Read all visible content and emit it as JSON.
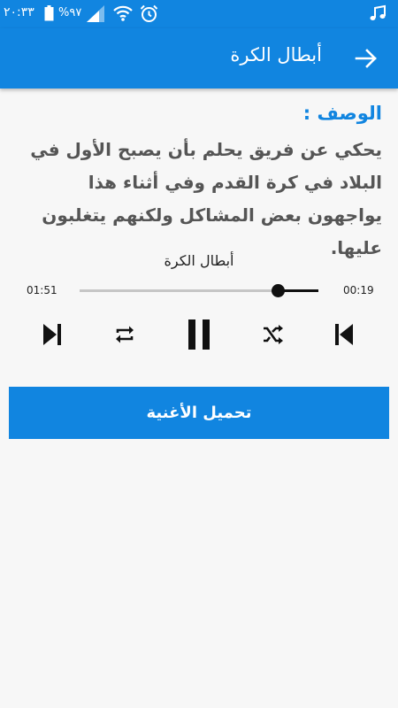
{
  "status_bar": {
    "time": "٢٠:٣٣",
    "battery": "%٩٧",
    "icons": [
      "music-icon",
      "alarm-icon",
      "wifi-icon",
      "signal-icon",
      "battery-icon"
    ]
  },
  "app_bar": {
    "title": "أبطال الكرة",
    "back_icon": "arrow-right-icon"
  },
  "description": {
    "heading": "الوصف :",
    "text": "يحكي عن فريق يحلم بأن يصبح الأول في البلاد في كرة القدم وفي أثناء هذا يواجهون بعض المشاكل ولكنهم يتغلبون عليها."
  },
  "player": {
    "track_title": "أبطال الكرة",
    "elapsed_display": "01:51",
    "remaining_display": "00:19",
    "progress_fraction": 0.83,
    "controls": [
      "skip-next-icon",
      "repeat-icon",
      "pause-icon",
      "shuffle-icon",
      "skip-previous-icon"
    ]
  },
  "download": {
    "label": "تحميل الأغنية"
  },
  "colors": {
    "primary": "#1185e0",
    "background": "#f7f7f7",
    "text_dark": "#555555"
  }
}
